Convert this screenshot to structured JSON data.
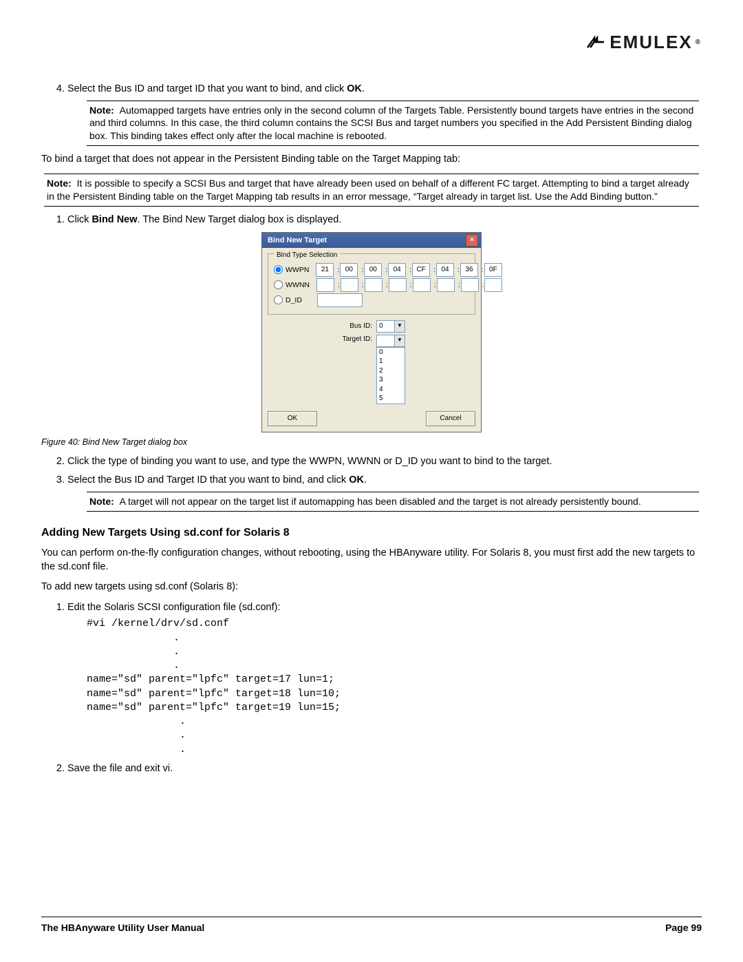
{
  "brand": "EMULEX",
  "sectionA": {
    "step4": {
      "text_prefix": "Select the Bus ID and target ID that you want to bind, and click ",
      "text_bold": "OK",
      "text_suffix": "."
    },
    "note4": {
      "label": "Note:",
      "body": "Automapped targets have entries only in the second column of the Targets Table. Persistently bound targets have entries in the second and third columns. In this case, the third column contains the SCSI Bus and target numbers you specified in the Add Persistent Binding dialog box. This binding takes effect only after the local machine is rebooted."
    },
    "para1": "To bind a target that does not appear in the Persistent Binding table on the Target Mapping tab:",
    "note_pre": {
      "label": "Note:",
      "body": "It is possible to specify a SCSI Bus and target that have already been used on behalf of a different FC target. Attempting to bind a target already in the Persistent Binding table on the Target Mapping tab results in an error message, “Target already in target list. Use the Add Binding button.”"
    },
    "step1": {
      "prefix": "Click ",
      "bold": "Bind New",
      "suffix": ". The Bind New Target dialog box is displayed."
    }
  },
  "dialog": {
    "title": "Bind New Target",
    "legend": "Bind Type Selection",
    "r_wwpn": "WWPN",
    "r_wwnn": "WWNN",
    "r_did": "D_ID",
    "hex": [
      "21",
      "00",
      "00",
      "04",
      "CF",
      "04",
      "36",
      "0F"
    ],
    "busid_label": "Bus ID:",
    "busid_value": "0",
    "targetid_label": "Target ID:",
    "target_options": [
      "0",
      "1",
      "2",
      "3",
      "4",
      "5"
    ],
    "ok": "OK",
    "cancel": "Cancel"
  },
  "caption": "Figure 40: Bind New Target dialog box",
  "sectionB": {
    "step2": "Click the type of binding you want to use, and type the WWPN, WWNN or D_ID you want to bind to the target.",
    "step3": {
      "prefix": "Select the Bus ID and Target ID that you want to bind, and click ",
      "bold": "OK",
      "suffix": "."
    },
    "note3": {
      "label": "Note:",
      "body": "A target will not appear on the target list if automapping has been disabled and the target is not already persistently bound."
    }
  },
  "heading": "Adding New Targets Using sd.conf for Solaris 8",
  "para2": "You can perform on-the-fly configuration changes, without rebooting, using the HBAnyware utility. For Solaris 8, you must first add the new targets to the sd.conf file.",
  "para3": "To add new targets using sd.conf (Solaris 8):",
  "stepsC": {
    "s1": "Edit the Solaris SCSI configuration file (sd.conf):",
    "code": "#vi /kernel/drv/sd.conf\n              .\n              .\n              .\nname=\"sd\" parent=\"lpfc\" target=17 lun=1;\nname=\"sd\" parent=\"lpfc\" target=18 lun=10;\nname=\"sd\" parent=\"lpfc\" target=19 lun=15;\n               .\n               .\n               .",
    "s2": "Save the file and exit vi."
  },
  "footer": {
    "left": "The HBAnyware Utility User Manual",
    "right": "Page 99"
  }
}
